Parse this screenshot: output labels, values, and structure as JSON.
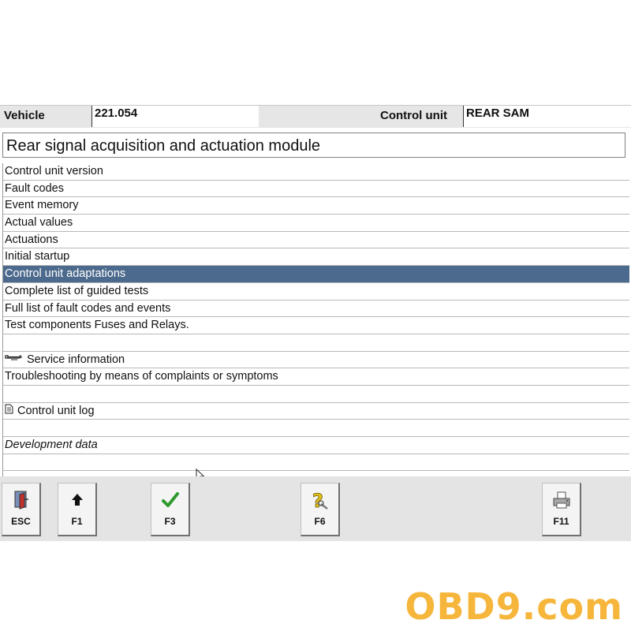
{
  "header": {
    "vehicle_label": "Vehicle",
    "vehicle_value": "221.054",
    "control_unit_label": "Control unit",
    "control_unit_value": "REAR SAM"
  },
  "module_title": "Rear signal acquisition and actuation module",
  "menu": {
    "items": [
      {
        "label": "Control unit version"
      },
      {
        "label": "Fault codes"
      },
      {
        "label": "Event memory"
      },
      {
        "label": "Actual values"
      },
      {
        "label": "Actuations"
      },
      {
        "label": "Initial startup"
      },
      {
        "label": "Control unit adaptations",
        "selected": true
      },
      {
        "label": "Complete list of guided tests"
      },
      {
        "label": "Full list of fault codes and events"
      },
      {
        "label": "Test components Fuses and Relays."
      },
      {
        "label": ""
      },
      {
        "label": "Service information",
        "icon": "wrench-icon"
      },
      {
        "label": "Troubleshooting by means of complaints or symptoms"
      },
      {
        "label": ""
      },
      {
        "label": "Control unit log",
        "icon": "document-icon"
      },
      {
        "label": ""
      },
      {
        "label": "Development data",
        "italic": true
      },
      {
        "label": ""
      }
    ]
  },
  "toolbar": {
    "buttons": [
      {
        "label": "ESC",
        "icon": "exit-door-icon"
      },
      {
        "label": "F1",
        "icon": "arrow-up-icon"
      },
      {
        "label": "F3",
        "icon": "checkmark-icon"
      },
      {
        "label": "F6",
        "icon": "help-question-icon"
      },
      {
        "label": "F11",
        "icon": "printer-icon"
      }
    ]
  },
  "colors": {
    "selected_row": "#4c6a8d",
    "checkmark": "#2e9a2e",
    "help_icon": "#e4c21a",
    "watermark": "#f6b63c"
  },
  "watermark": "OBD9.com"
}
